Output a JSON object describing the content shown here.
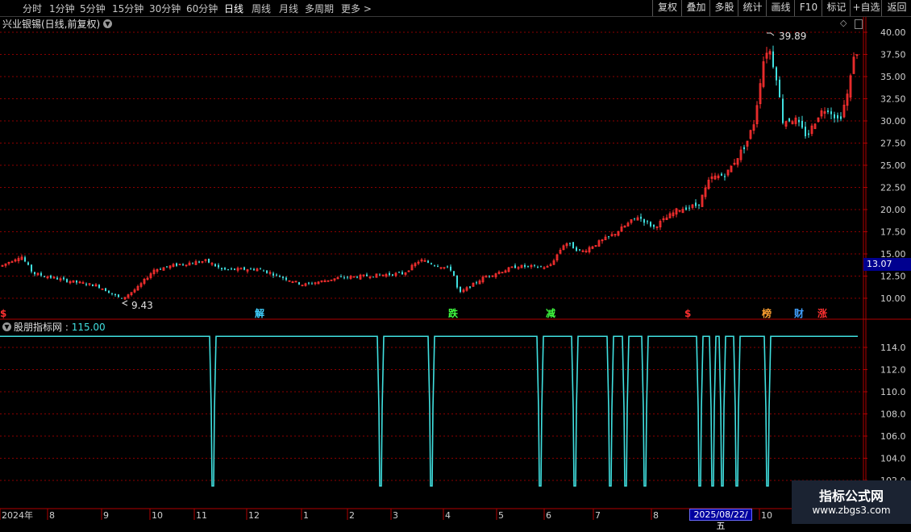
{
  "toolbar": {
    "periods": [
      "分时",
      "1分钟",
      "5分钟",
      "15分钟",
      "30分钟",
      "60分钟",
      "日线",
      "周线",
      "月线",
      "多周期",
      "更多"
    ],
    "active": "日线",
    "right_buttons": [
      "复权",
      "叠加",
      "多股",
      "统计",
      "画线",
      "F10",
      "+自选",
      "返回"
    ],
    "right_tab": "标记"
  },
  "stock": {
    "title": "兴业银锡(日线,前复权)",
    "current_price": "13.07",
    "high_label": "39.89",
    "low_label": "9.43"
  },
  "price_axis": [
    "40.00",
    "37.50",
    "35.00",
    "32.50",
    "30.00",
    "27.50",
    "25.00",
    "22.50",
    "20.00",
    "17.50",
    "15.00",
    "12.50",
    "10.00"
  ],
  "events": [
    {
      "label": "$",
      "color": "#ff3030"
    },
    {
      "label": "解",
      "color": "#40d0ff"
    },
    {
      "label": "跌",
      "color": "#40ff40"
    },
    {
      "label": "减",
      "color": "#40ff40"
    },
    {
      "label": "$",
      "color": "#ff3030"
    },
    {
      "label": "榜",
      "color": "#ffa030"
    },
    {
      "label": "财",
      "color": "#40a0ff"
    },
    {
      "label": "涨",
      "color": "#ff3030"
    }
  ],
  "indicator": {
    "name": "股朋指标网",
    "value": "115.00",
    "axis": [
      "114.0",
      "112.0",
      "110.0",
      "108.0",
      "106.0",
      "104.0",
      "102.0"
    ],
    "color": "#40e0e0"
  },
  "time_axis": [
    "2024年",
    "8",
    "9",
    "10",
    "11",
    "12",
    "1",
    "2",
    "3",
    "4",
    "5",
    "6",
    "7",
    "8",
    "10"
  ],
  "selected_date": "2025/08/22/五",
  "watermark": {
    "title": "指标公式网",
    "url": "www.zbgs3.com"
  },
  "colors": {
    "up": "#ff3030",
    "down": "#40e0e0",
    "grid": "#8b0000",
    "frame": "#b00000"
  }
}
